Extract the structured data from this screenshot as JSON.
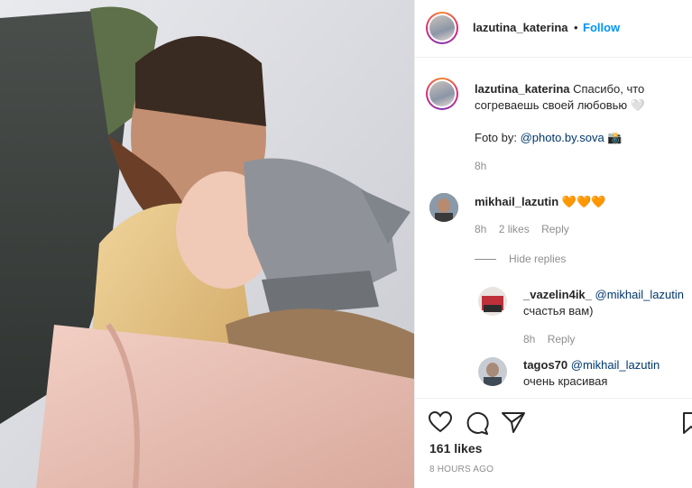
{
  "post": {
    "username": "lazutina_katerina",
    "separator": "•",
    "follow_label": "Follow"
  },
  "caption": {
    "username": "lazutina_katerina",
    "text": "Спасибо, что согреваешь своей любовью 🤍",
    "foto_prefix": "Foto by: ",
    "foto_mention": "@photo.by.sova",
    "foto_emoji": "📸",
    "time": "8h"
  },
  "comments": [
    {
      "username": "mikhail_lazutin",
      "text": "🧡🧡🧡",
      "time": "8h",
      "likes": "2 likes",
      "reply_label": "Reply",
      "hide_replies_label": "Hide replies"
    }
  ],
  "replies": [
    {
      "username": "_vazelin4ik_",
      "mention": "@mikhail_lazutin",
      "text": "счастья вам)",
      "time": "8h",
      "reply_label": "Reply"
    },
    {
      "username": "tagos70",
      "mention": "@mikhail_lazutin",
      "text": "очень красивая"
    }
  ],
  "footer": {
    "likes": "161 likes",
    "timestamp": "8 HOURS AGO"
  },
  "icons": [
    "heart-icon",
    "comment-icon",
    "share-icon",
    "bookmark-icon"
  ]
}
